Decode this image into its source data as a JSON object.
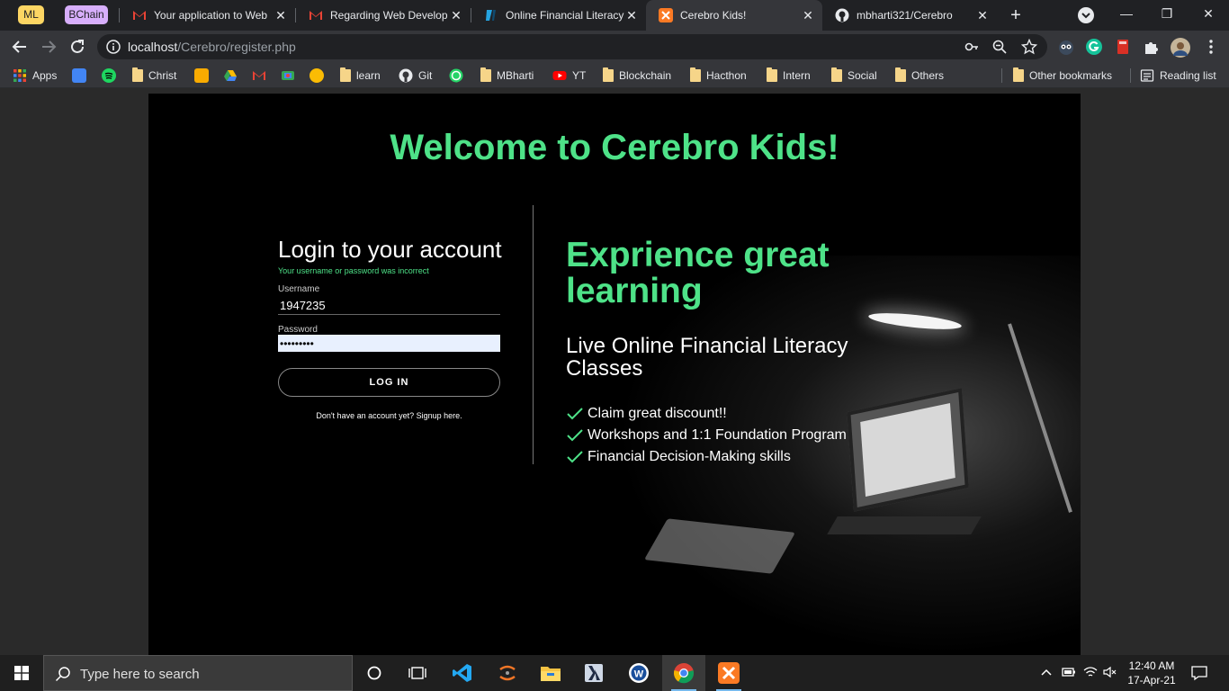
{
  "tab_groups": [
    {
      "label": "ML",
      "color": "#fdd663"
    },
    {
      "label": "BChain",
      "color": "#d7aefb"
    }
  ],
  "tabs": [
    {
      "title": "Your application to Web",
      "favicon": "gmail-icon"
    },
    {
      "title": "Regarding Web Develop",
      "favicon": "gmail-icon"
    },
    {
      "title": "Online Financial Literacy",
      "favicon": "site-icon"
    },
    {
      "title": "Cerebro Kids!",
      "favicon": "xampp-icon",
      "active": true
    },
    {
      "title": "mbharti321/Cerebro",
      "favicon": "github-icon"
    }
  ],
  "address_bar": {
    "host": "localhost",
    "path": "/Cerebro/register.php"
  },
  "bookmarks": [
    {
      "label": "Apps",
      "icon": "apps-grid-icon"
    },
    {
      "label": "",
      "icon": "google-classroom-icon"
    },
    {
      "label": "",
      "icon": "spotify-icon"
    },
    {
      "label": "Christ",
      "icon": "folder-icon"
    },
    {
      "label": "",
      "icon": "google-classroom-icon"
    },
    {
      "label": "",
      "icon": "google-drive-icon"
    },
    {
      "label": "",
      "icon": "gmail-icon"
    },
    {
      "label": "",
      "icon": "google-photos-icon"
    },
    {
      "label": "",
      "icon": "keep-icon"
    },
    {
      "label": "learn",
      "icon": "folder-icon"
    },
    {
      "label": "Git",
      "icon": "github-icon"
    },
    {
      "label": "",
      "icon": "whatsapp-icon"
    },
    {
      "label": "MBharti",
      "icon": "folder-icon"
    },
    {
      "label": "YT",
      "icon": "youtube-icon"
    },
    {
      "label": "Blockchain",
      "icon": "folder-icon"
    },
    {
      "label": "Hacthon",
      "icon": "folder-icon"
    },
    {
      "label": "Intern",
      "icon": "folder-icon"
    },
    {
      "label": "Social",
      "icon": "folder-icon"
    },
    {
      "label": "Others",
      "icon": "folder-icon"
    }
  ],
  "other_bookmarks": "Other bookmarks",
  "reading_list": "Reading list",
  "page": {
    "welcome": "Welcome to Cerebro Kids!",
    "login_title": "Login to your account",
    "login_error": "Your username or password was incorrect",
    "username_label": "Username",
    "username_value": "1947235",
    "password_label": "Password",
    "password_value": "•••••••••",
    "login_button": "LOG IN",
    "signup_text": "Don't have an account yet? Signup here.",
    "headline": "Exprience great learning",
    "subheadline": "Live Online Financial Literacy Classes",
    "features": [
      "Claim great discount!!",
      "Workshops and 1:1 Foundation Program",
      "Financial Decision-Making skills"
    ],
    "accent_color": "#4ee288"
  },
  "taskbar": {
    "search_placeholder": "Type here to search",
    "apps": [
      "cortana-icon",
      "task-view-icon",
      "vscode-icon",
      "jupyter-icon",
      "file-explorer-icon",
      "eclipse-icon",
      "word-icon",
      "chrome-icon",
      "xampp-icon"
    ],
    "time": "12:40 AM",
    "date": "17-Apr-21"
  }
}
